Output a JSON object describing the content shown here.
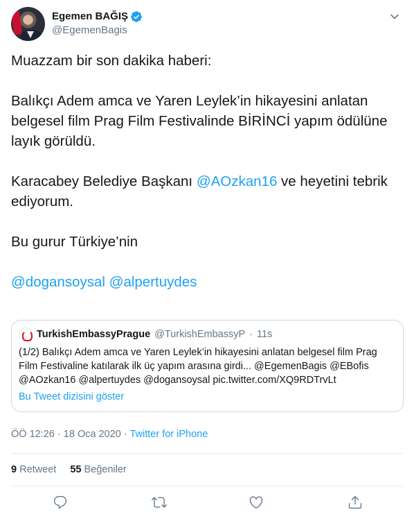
{
  "author": {
    "display_name": "Egemen BAĞIŞ",
    "handle": "@EgemenBagis"
  },
  "tweet": {
    "line1": "Muazzam bir son dakika haberi:",
    "para2": "Balıkçı Adem amca ve Yaren Leylek’in hikayesini anlatan belgesel film Prag Film Festivalinde BİRİNCİ yapım ödülüne layık görüldü.",
    "para3_pre": "Karacabey Belediye Başkanı ",
    "para3_mention": "@AOzkan16",
    "para3_post": " ve heyetini tebrik ediyorum.",
    "para4": "Bu gurur Türkiye’nin",
    "mention1": "@dogansoysal",
    "mention2": "@alpertuydes"
  },
  "quote": {
    "name": "TurkishEmbassyPrague",
    "handle": "@TurkishEmbassyP",
    "separator": "·",
    "time": "11s",
    "text": "(1/2) Balıkçı Adem amca ve Yaren Leylek’in hikayesini anlatan belgesel film Prag Film Festivaline katılarak ilk üç yapım arasına girdi... @EgemenBagis @EBofis @AOzkan16 @alpertuydes @dogansoysal pic.twitter.com/XQ9RDTrvLt",
    "link": "Bu Tweet dizisini göster"
  },
  "meta": {
    "time": "ÖÖ 12:26",
    "date": "18 Oca 2020",
    "dot": "·",
    "source": "Twitter for iPhone"
  },
  "stats": {
    "retweets_count": "9",
    "retweets_label": "Retweet",
    "likes_count": "55",
    "likes_label": "Beğeniler"
  },
  "icons": {
    "verified": "verified-badge-icon",
    "caret": "chevron-down-icon",
    "reply": "reply-icon",
    "retweet": "retweet-icon",
    "like": "heart-icon",
    "share": "share-icon"
  },
  "colors": {
    "link": "#1da1f2",
    "secondary": "#657786",
    "text": "#14171a"
  }
}
